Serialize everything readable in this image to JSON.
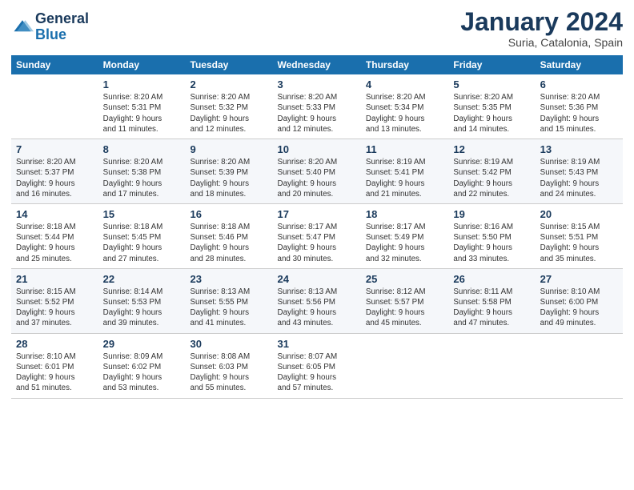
{
  "header": {
    "logo_line1": "General",
    "logo_line2": "Blue",
    "month": "January 2024",
    "location": "Suria, Catalonia, Spain"
  },
  "weekdays": [
    "Sunday",
    "Monday",
    "Tuesday",
    "Wednesday",
    "Thursday",
    "Friday",
    "Saturday"
  ],
  "weeks": [
    [
      {
        "day": "",
        "info": ""
      },
      {
        "day": "1",
        "info": "Sunrise: 8:20 AM\nSunset: 5:31 PM\nDaylight: 9 hours\nand 11 minutes."
      },
      {
        "day": "2",
        "info": "Sunrise: 8:20 AM\nSunset: 5:32 PM\nDaylight: 9 hours\nand 12 minutes."
      },
      {
        "day": "3",
        "info": "Sunrise: 8:20 AM\nSunset: 5:33 PM\nDaylight: 9 hours\nand 12 minutes."
      },
      {
        "day": "4",
        "info": "Sunrise: 8:20 AM\nSunset: 5:34 PM\nDaylight: 9 hours\nand 13 minutes."
      },
      {
        "day": "5",
        "info": "Sunrise: 8:20 AM\nSunset: 5:35 PM\nDaylight: 9 hours\nand 14 minutes."
      },
      {
        "day": "6",
        "info": "Sunrise: 8:20 AM\nSunset: 5:36 PM\nDaylight: 9 hours\nand 15 minutes."
      }
    ],
    [
      {
        "day": "7",
        "info": "Sunrise: 8:20 AM\nSunset: 5:37 PM\nDaylight: 9 hours\nand 16 minutes."
      },
      {
        "day": "8",
        "info": "Sunrise: 8:20 AM\nSunset: 5:38 PM\nDaylight: 9 hours\nand 17 minutes."
      },
      {
        "day": "9",
        "info": "Sunrise: 8:20 AM\nSunset: 5:39 PM\nDaylight: 9 hours\nand 18 minutes."
      },
      {
        "day": "10",
        "info": "Sunrise: 8:20 AM\nSunset: 5:40 PM\nDaylight: 9 hours\nand 20 minutes."
      },
      {
        "day": "11",
        "info": "Sunrise: 8:19 AM\nSunset: 5:41 PM\nDaylight: 9 hours\nand 21 minutes."
      },
      {
        "day": "12",
        "info": "Sunrise: 8:19 AM\nSunset: 5:42 PM\nDaylight: 9 hours\nand 22 minutes."
      },
      {
        "day": "13",
        "info": "Sunrise: 8:19 AM\nSunset: 5:43 PM\nDaylight: 9 hours\nand 24 minutes."
      }
    ],
    [
      {
        "day": "14",
        "info": "Sunrise: 8:18 AM\nSunset: 5:44 PM\nDaylight: 9 hours\nand 25 minutes."
      },
      {
        "day": "15",
        "info": "Sunrise: 8:18 AM\nSunset: 5:45 PM\nDaylight: 9 hours\nand 27 minutes."
      },
      {
        "day": "16",
        "info": "Sunrise: 8:18 AM\nSunset: 5:46 PM\nDaylight: 9 hours\nand 28 minutes."
      },
      {
        "day": "17",
        "info": "Sunrise: 8:17 AM\nSunset: 5:47 PM\nDaylight: 9 hours\nand 30 minutes."
      },
      {
        "day": "18",
        "info": "Sunrise: 8:17 AM\nSunset: 5:49 PM\nDaylight: 9 hours\nand 32 minutes."
      },
      {
        "day": "19",
        "info": "Sunrise: 8:16 AM\nSunset: 5:50 PM\nDaylight: 9 hours\nand 33 minutes."
      },
      {
        "day": "20",
        "info": "Sunrise: 8:15 AM\nSunset: 5:51 PM\nDaylight: 9 hours\nand 35 minutes."
      }
    ],
    [
      {
        "day": "21",
        "info": "Sunrise: 8:15 AM\nSunset: 5:52 PM\nDaylight: 9 hours\nand 37 minutes."
      },
      {
        "day": "22",
        "info": "Sunrise: 8:14 AM\nSunset: 5:53 PM\nDaylight: 9 hours\nand 39 minutes."
      },
      {
        "day": "23",
        "info": "Sunrise: 8:13 AM\nSunset: 5:55 PM\nDaylight: 9 hours\nand 41 minutes."
      },
      {
        "day": "24",
        "info": "Sunrise: 8:13 AM\nSunset: 5:56 PM\nDaylight: 9 hours\nand 43 minutes."
      },
      {
        "day": "25",
        "info": "Sunrise: 8:12 AM\nSunset: 5:57 PM\nDaylight: 9 hours\nand 45 minutes."
      },
      {
        "day": "26",
        "info": "Sunrise: 8:11 AM\nSunset: 5:58 PM\nDaylight: 9 hours\nand 47 minutes."
      },
      {
        "day": "27",
        "info": "Sunrise: 8:10 AM\nSunset: 6:00 PM\nDaylight: 9 hours\nand 49 minutes."
      }
    ],
    [
      {
        "day": "28",
        "info": "Sunrise: 8:10 AM\nSunset: 6:01 PM\nDaylight: 9 hours\nand 51 minutes."
      },
      {
        "day": "29",
        "info": "Sunrise: 8:09 AM\nSunset: 6:02 PM\nDaylight: 9 hours\nand 53 minutes."
      },
      {
        "day": "30",
        "info": "Sunrise: 8:08 AM\nSunset: 6:03 PM\nDaylight: 9 hours\nand 55 minutes."
      },
      {
        "day": "31",
        "info": "Sunrise: 8:07 AM\nSunset: 6:05 PM\nDaylight: 9 hours\nand 57 minutes."
      },
      {
        "day": "",
        "info": ""
      },
      {
        "day": "",
        "info": ""
      },
      {
        "day": "",
        "info": ""
      }
    ]
  ]
}
